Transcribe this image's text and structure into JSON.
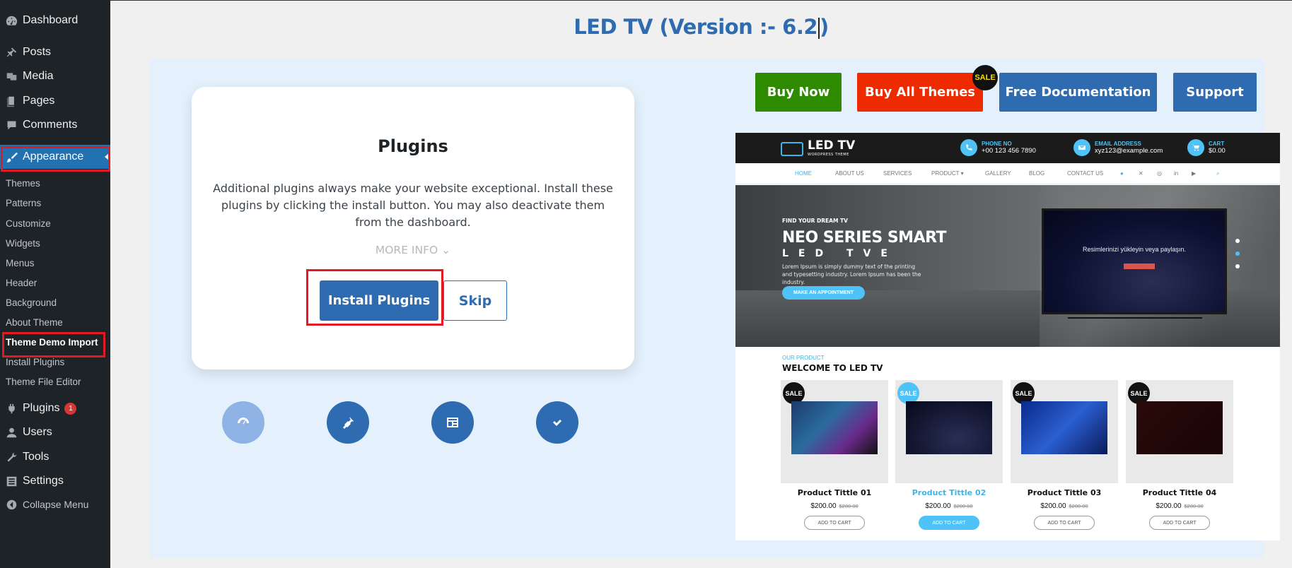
{
  "sidebar": {
    "dashboard": "Dashboard",
    "posts": "Posts",
    "media": "Media",
    "pages": "Pages",
    "comments": "Comments",
    "appearance": "Appearance",
    "sub": {
      "themes": "Themes",
      "patterns": "Patterns",
      "customize": "Customize",
      "widgets": "Widgets",
      "menus": "Menus",
      "header": "Header",
      "background": "Background",
      "about_theme": "About Theme",
      "theme_demo_import": "Theme Demo Import",
      "install_plugins": "Install Plugins",
      "theme_file_editor": "Theme File Editor"
    },
    "plugins": "Plugins",
    "plugins_badge": "1",
    "users": "Users",
    "tools": "Tools",
    "settings": "Settings",
    "collapse": "Collapse Menu"
  },
  "page": {
    "title": "LED TV (Version :- 6.2"
  },
  "card": {
    "heading": "Plugins",
    "text": "Additional plugins always make your website exceptional. Install these plugins by clicking the install button. You may also deactivate them from the dashboard.",
    "more_info": "MORE INFO ⌄",
    "install_label": "Install Plugins",
    "skip_label": "Skip"
  },
  "steps": [
    {
      "icon": "dashboard-icon"
    },
    {
      "icon": "plug-icon"
    },
    {
      "icon": "layout-icon"
    },
    {
      "icon": "check-icon"
    }
  ],
  "actions": {
    "buy_now": "Buy Now",
    "buy_all": "Buy All Themes",
    "sale": "SALE",
    "docs": "Free Documentation",
    "support": "Support"
  },
  "preview": {
    "logo": "LED TV",
    "logo_sub": "WORDPRESS THEME",
    "phone_label": "PHONE NO",
    "phone": "+00 123 456 7890",
    "email_label": "EMAIL ADDRESS",
    "email": "xyz123@example.com",
    "cart_label": "CART",
    "cart": "$0.00",
    "nav": [
      "HOME",
      "ABOUT US",
      "SERVICES",
      "PRODUCT ▾",
      "GALLERY",
      "BLOG",
      "CONTACT US"
    ],
    "hero_kicker": "FIND YOUR DREAM TV",
    "hero_title": "NEO SERIES SMART",
    "hero_sub": "LED TVE",
    "hero_text": "Lorem Ipsum is simply dummy text of the printing and typesetting industry. Lorem Ipsum has been the industry.",
    "hero_btn": "MAKE AN APPOINTMENT",
    "tv_text": "Resimlerinizi yükleyin veya paylaşın.",
    "our_product": "OUR PRODUCT",
    "welcome": "WELCOME TO LED TV",
    "products": [
      {
        "sale": "SALE",
        "name": "Product Tittle 01",
        "price": "$200.00",
        "old": "$200.00",
        "cart": "ADD TO CART"
      },
      {
        "sale": "SALE",
        "name": "Product Tittle 02",
        "price": "$200.00",
        "old": "$200.00",
        "cart": "ADD TO CART"
      },
      {
        "sale": "SALE",
        "name": "Product Tittle 03",
        "price": "$200.00",
        "old": "$200.00",
        "cart": "ADD TO CART"
      },
      {
        "sale": "SALE",
        "name": "Product Tittle 04",
        "price": "$200.00",
        "old": "$200.00",
        "cart": "ADD TO CART"
      }
    ]
  },
  "colors": {
    "wp_blue": "#2271b1",
    "theme_blue": "#2f6bb0",
    "buy_now": "#2e8b00",
    "buy_all": "#ee2a00",
    "highlight": "#e01b24"
  }
}
